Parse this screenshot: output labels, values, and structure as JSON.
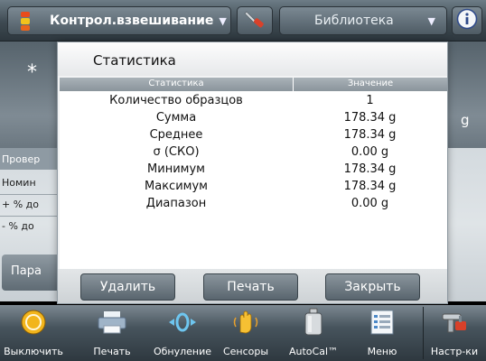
{
  "topbar": {
    "mode_label": "Контрол.взвешивание",
    "library_label": "Библиотека"
  },
  "background": {
    "star": "*",
    "unit": "g",
    "side": {
      "check": "Провер",
      "nominal": "Номин",
      "plus": "+ % до",
      "minus": "- % до",
      "params": "Пара"
    }
  },
  "dialog": {
    "title": "Статистика",
    "columns": {
      "name": "Статистика",
      "value": "Значение"
    },
    "rows": [
      {
        "name": "Количество образцов",
        "value": "1"
      },
      {
        "name": "Сумма",
        "value": "178.34 g"
      },
      {
        "name": "Среднее",
        "value": "178.34 g"
      },
      {
        "name": "σ (СКО)",
        "value": "0.00 g"
      },
      {
        "name": "Минимум",
        "value": "178.34 g"
      },
      {
        "name": "Максимум",
        "value": "178.34 g"
      },
      {
        "name": "Диапазон",
        "value": "0.00 g"
      }
    ],
    "buttons": {
      "delete": "Удалить",
      "print": "Печать",
      "close": "Закрыть"
    }
  },
  "bottombar": {
    "items": [
      {
        "label": "Выключить",
        "icon": "power-icon"
      },
      {
        "label": "Печать",
        "icon": "printer-icon"
      },
      {
        "label": "Обнуление",
        "icon": "zero-icon"
      },
      {
        "label": "Сенсоры",
        "icon": "sensor-hand-icon"
      },
      {
        "label": "AutoCal™",
        "icon": "calibration-weight-icon"
      },
      {
        "label": "Меню",
        "icon": "menu-list-icon"
      },
      {
        "label": "Настр-ки",
        "icon": "settings-tools-icon"
      }
    ]
  },
  "colors": {
    "bar_top": "#6d7c86",
    "bar_bottom": "#2d373e",
    "header_grey": "#8a949b",
    "dialog_bg": "#f2f3f4"
  }
}
